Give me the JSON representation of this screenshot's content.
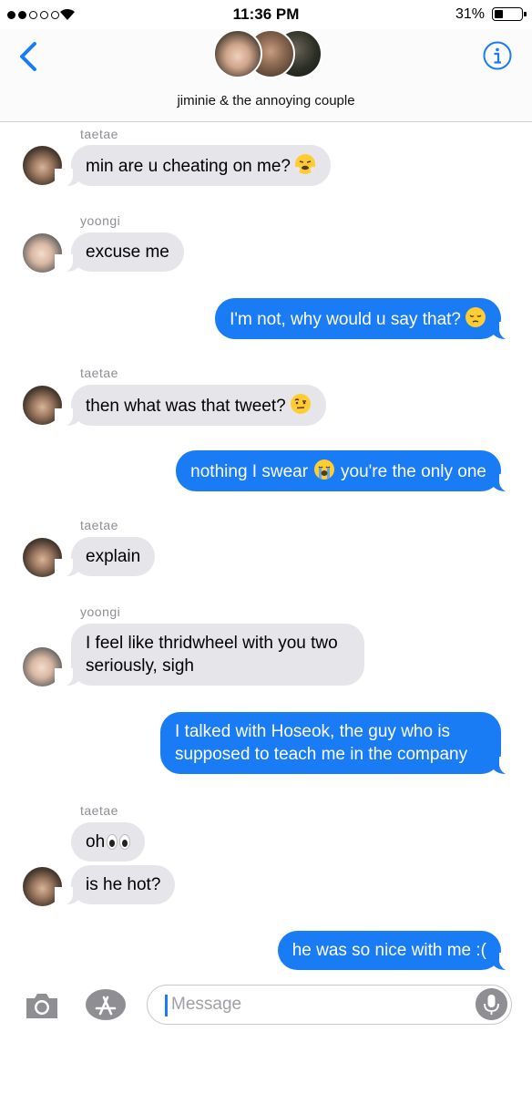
{
  "status_bar": {
    "time": "11:36 PM",
    "battery_percent": "31%",
    "signal_bars_filled": 2,
    "signal_bars_total": 5
  },
  "header": {
    "group_name": "jiminie & the annoying couple",
    "back_icon": "chevron-left-icon",
    "info_icon": "info-icon"
  },
  "messages": [
    {
      "sender": "taetae",
      "text": "min are u cheating on me?",
      "emoji": "huffing-face"
    },
    {
      "sender": "yoongi",
      "text": "excuse me"
    },
    {
      "text": "I'm not, why would u say that?",
      "emoji": "pensive-face"
    },
    {
      "sender": "taetae",
      "text": "then what was that tweet?",
      "emoji": "raised-eyebrow-face"
    },
    {
      "text_before": "nothing I swear",
      "emoji": "crying-face",
      "text_after": "you're the only one"
    },
    {
      "sender": "taetae",
      "text": "explain"
    },
    {
      "sender": "yoongi",
      "lines": [
        "I feel like thridwheel with you two",
        "seriously, sigh"
      ]
    },
    {
      "lines": [
        "I talked with Hoseok, the guy who is",
        "supposed to teach me in the company"
      ]
    },
    {
      "sender": "taetae",
      "text": "oh",
      "emoji": "eyes"
    },
    {
      "text": "is he hot?"
    },
    {
      "text": "he was so nice with me :("
    }
  ],
  "input_bar": {
    "placeholder": "Message",
    "camera_icon": "camera-icon",
    "apps_icon": "app-store-icon",
    "mic_icon": "microphone-icon"
  },
  "colors": {
    "outgoing_bubble": "#1a7cf5",
    "incoming_bubble": "#e5e5ea",
    "accent": "#1a7cf5"
  }
}
